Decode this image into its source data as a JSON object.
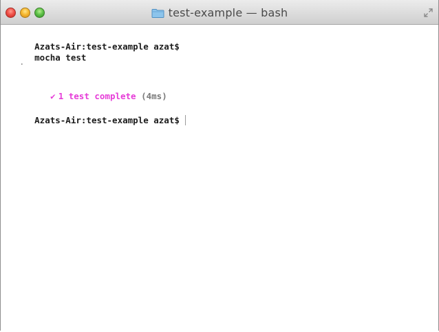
{
  "window": {
    "title": "test-example — bash",
    "title_icon": "folder-icon",
    "controls": [
      "close-button",
      "minimize-button",
      "zoom-button"
    ],
    "fullscreen_icon": "fullscreen-icon"
  },
  "terminal": {
    "prompt_1": "Azats-Air:test-example azat$",
    "command_1": "mocha test",
    "progress_dot": ".",
    "result": {
      "check_glyph": "✔",
      "text": "1 test complete",
      "duration": "(4ms)"
    },
    "prompt_2": "Azats-Air:test-example azat$"
  },
  "colors": {
    "pass_accent": "#e63dd8",
    "text": "#1c1c1c",
    "muted": "#7a7a7a"
  }
}
